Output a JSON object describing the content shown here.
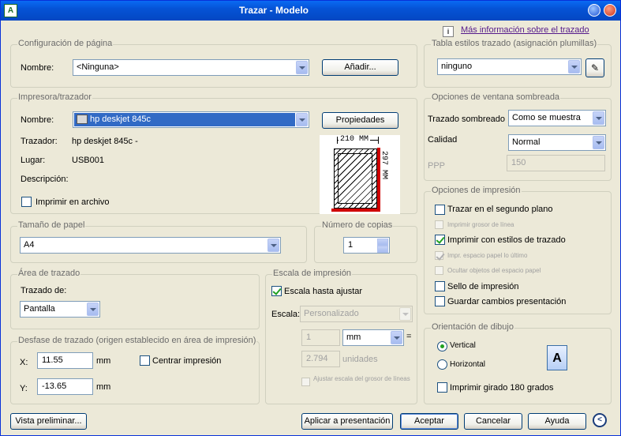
{
  "title": "Trazar - Modelo",
  "info_link": "Más información sobre el trazado",
  "page_setup": {
    "legend": "Configuración de página",
    "name_label": "Nombre:",
    "name_value": "<Ninguna>",
    "add_button": "Añadir..."
  },
  "plot_style_table": {
    "legend": "Tabla estilos trazado (asignación plumillas)",
    "value": "ninguno"
  },
  "printer": {
    "legend": "Impresora/trazador",
    "name_label": "Nombre:",
    "name_value": "hp deskjet 845c",
    "properties_button": "Propiedades",
    "plotter_label": "Trazador:",
    "plotter_value": "hp deskjet 845c -",
    "where_label": "Lugar:",
    "where_value": "USB001",
    "description_label": "Descripción:",
    "print_to_file": "Imprimir en archivo",
    "preview_width": "210 MM",
    "preview_height": "297 MM"
  },
  "shaded_viewport": {
    "legend": "Opciones de ventana sombreada",
    "shade_label": "Trazado sombreado",
    "shade_value": "Como se muestra",
    "quality_label": "Calidad",
    "quality_value": "Normal",
    "dpi_label": "PPP",
    "dpi_value": "150"
  },
  "plot_options": {
    "legend": "Opciones de impresión",
    "items": [
      {
        "label": "Trazar en el segundo plano",
        "checked": false,
        "enabled": true
      },
      {
        "label": "Imprimir grosor de línea",
        "checked": false,
        "enabled": false
      },
      {
        "label": "Imprimir con estilos de trazado",
        "checked": true,
        "enabled": true
      },
      {
        "label": "Impr. espacio papel lo último",
        "checked": true,
        "enabled": false
      },
      {
        "label": "Ocultar objetos del espacio papel",
        "checked": false,
        "enabled": false
      },
      {
        "label": "Sello de impresión",
        "checked": false,
        "enabled": true
      },
      {
        "label": "Guardar cambios presentación",
        "checked": false,
        "enabled": true
      }
    ]
  },
  "paper_size": {
    "legend": "Tamaño de papel",
    "value": "A4"
  },
  "copies": {
    "legend": "Número de copias",
    "value": "1"
  },
  "plot_area": {
    "legend": "Área de trazado",
    "what_label": "Trazado de:",
    "what_value": "Pantalla"
  },
  "plot_scale": {
    "legend": "Escala de impresión",
    "fit_label": "Escala hasta ajustar",
    "scale_label": "Escala:",
    "scale_value": "Personalizado",
    "value1": "1",
    "unit_value": "mm",
    "equals": "=",
    "value2": "2.794",
    "units_label": "unidades",
    "lineweights_label": "Ajustar escala del grosor de líneas"
  },
  "plot_offset": {
    "legend": "Desfase de trazado (origen establecido en área de impresión)",
    "x_label": "X:",
    "x_value": "11.55",
    "x_unit": "mm",
    "y_label": "Y:",
    "y_value": "-13.65",
    "y_unit": "mm",
    "center_label": "Centrar impresión"
  },
  "orientation": {
    "legend": "Orientación de dibujo",
    "portrait": "Vertical",
    "landscape": "Horizontal",
    "upside_down": "Imprimir girado 180 grados",
    "preview_letter": "A"
  },
  "buttons": {
    "preview": "Vista preliminar...",
    "apply": "Aplicar a presentación",
    "ok": "Aceptar",
    "cancel": "Cancelar",
    "help": "Ayuda"
  }
}
